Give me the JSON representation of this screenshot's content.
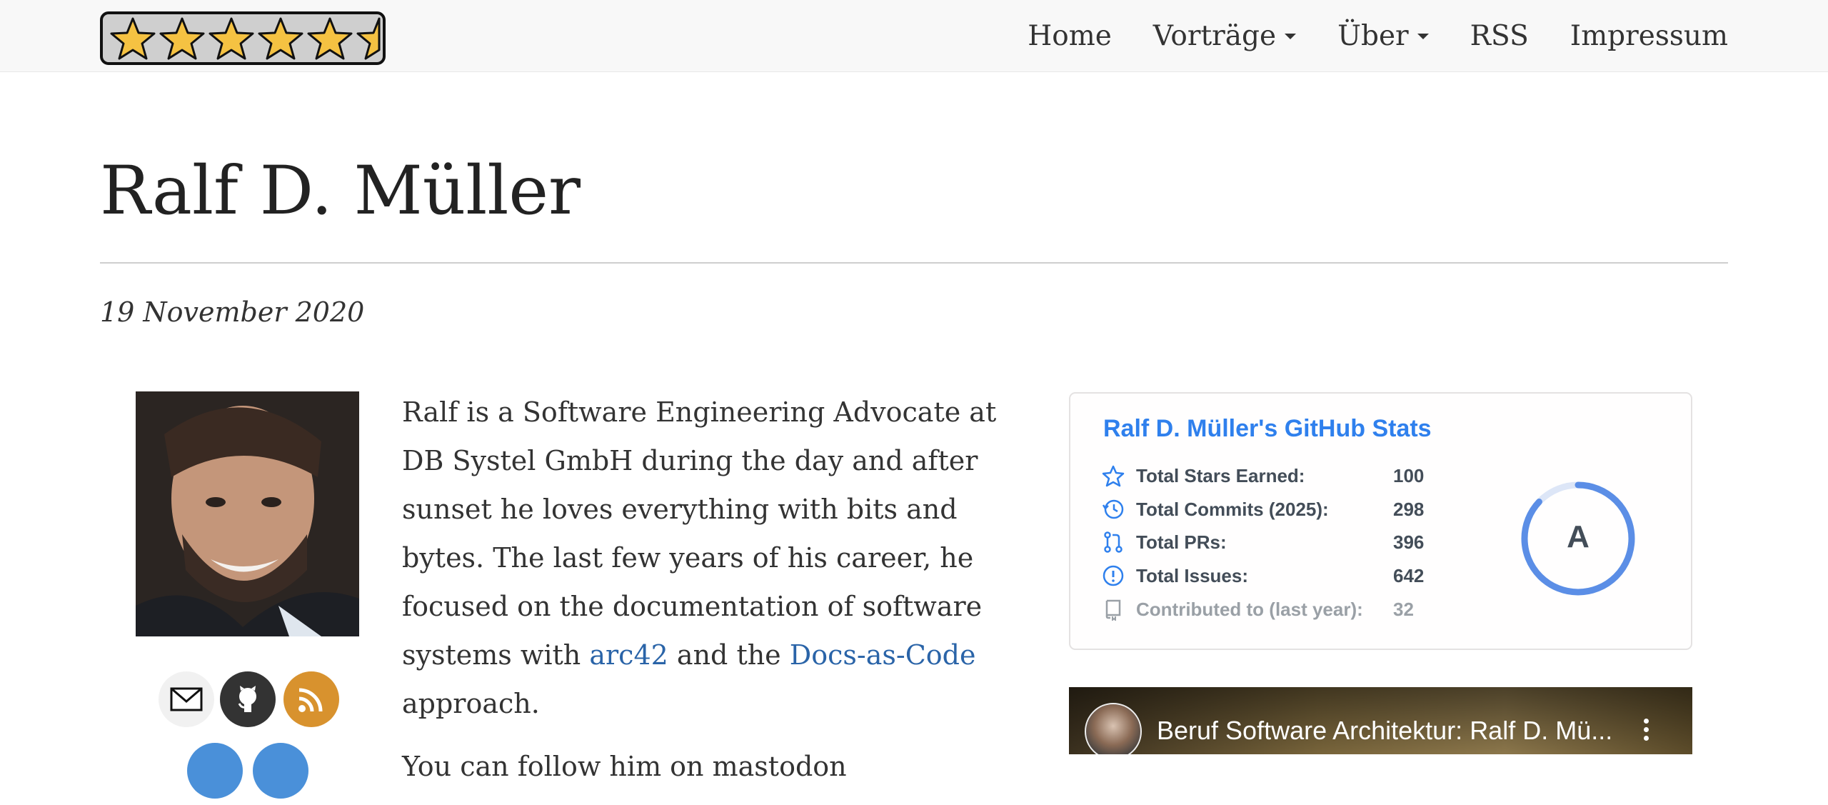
{
  "navbar": {
    "logo": "five-star-rating-logo",
    "items": [
      {
        "label": "Home",
        "dropdown": false
      },
      {
        "label": "Vorträge",
        "dropdown": true
      },
      {
        "label": "Über",
        "dropdown": true
      },
      {
        "label": "RSS",
        "dropdown": false
      },
      {
        "label": "Impressum",
        "dropdown": false
      }
    ]
  },
  "page": {
    "title": "Ralf D. Müller",
    "date": "19 November 2020"
  },
  "bio": {
    "p1_pre": "Ralf is a Software Engineering Advocate at DB Systel GmbH during the day and after sunset he loves everything with bits and bytes. The last few years of his career, he focused on the documentation of software systems with ",
    "link1": "arc42",
    "p1_mid": " and the ",
    "link2": "Docs-as-Code",
    "p1_post": " approach.",
    "p2": "You can follow him on mastodon"
  },
  "social": [
    {
      "icon": "mail-icon",
      "color": "#eeeeee"
    },
    {
      "icon": "github-icon",
      "color": "#333333"
    },
    {
      "icon": "rss-icon",
      "color": "#d8922e"
    }
  ],
  "github_stats": {
    "title": "Ralf D. Müller's GitHub Stats",
    "rows": [
      {
        "icon": "star-icon",
        "label": "Total Stars Earned:",
        "value": "100"
      },
      {
        "icon": "history-icon",
        "label": "Total Commits (2025):",
        "value": "298"
      },
      {
        "icon": "pull-request-icon",
        "label": "Total PRs:",
        "value": "396"
      },
      {
        "icon": "issue-icon",
        "label": "Total Issues:",
        "value": "642"
      },
      {
        "icon": "repo-icon",
        "label": "Contributed to (last year):",
        "value": "32"
      }
    ],
    "rank": "A",
    "rank_progress": 0.87,
    "accent": "#2f80ed"
  },
  "video": {
    "title": "Beruf Software Architektur: Ralf D. Mü..."
  }
}
